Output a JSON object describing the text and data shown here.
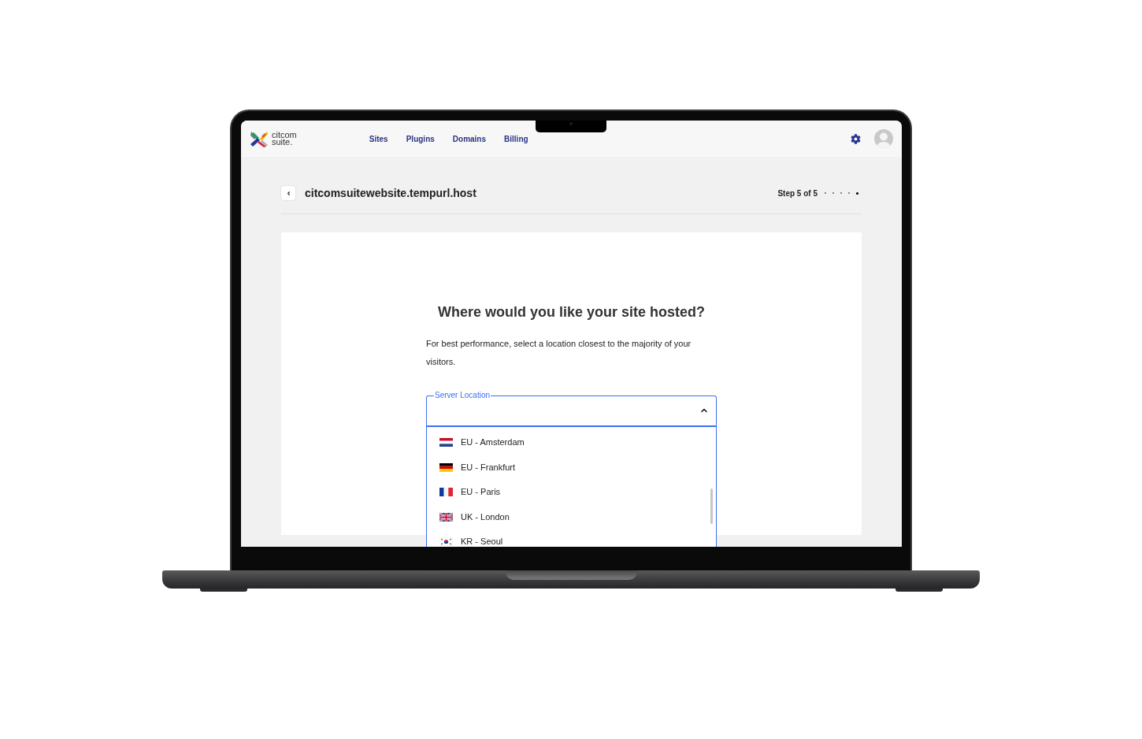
{
  "nav": {
    "logo": {
      "line_1": "citcom",
      "line_2": "suite."
    },
    "links": [
      {
        "label": "Sites"
      },
      {
        "label": "Plugins"
      },
      {
        "label": "Domains"
      },
      {
        "label": "Billing"
      }
    ]
  },
  "header": {
    "title": "citcomsuitewebsite.tempurl.host",
    "step_label": "Step 5 of 5",
    "step_dots": [
      {
        "selected": false
      },
      {
        "selected": false
      },
      {
        "selected": false
      },
      {
        "selected": false
      },
      {
        "selected": true
      }
    ]
  },
  "card": {
    "heading": "Where would you like your site hosted?",
    "description": "For best performance, select a location closest to the majority of your visitors.",
    "select": {
      "label": "Server Location",
      "expanded": true,
      "options": [
        {
          "label": "EU - Amsterdam",
          "kind": "nl",
          "selected": false
        },
        {
          "label": "EU - Frankfurt",
          "kind": "de",
          "selected": false
        },
        {
          "label": "EU - Paris",
          "kind": "fr",
          "selected": false
        },
        {
          "label": "UK - London",
          "kind": "gb",
          "selected": false
        },
        {
          "label": "KR - Seoul",
          "kind": "kr",
          "selected": false
        }
      ]
    }
  }
}
